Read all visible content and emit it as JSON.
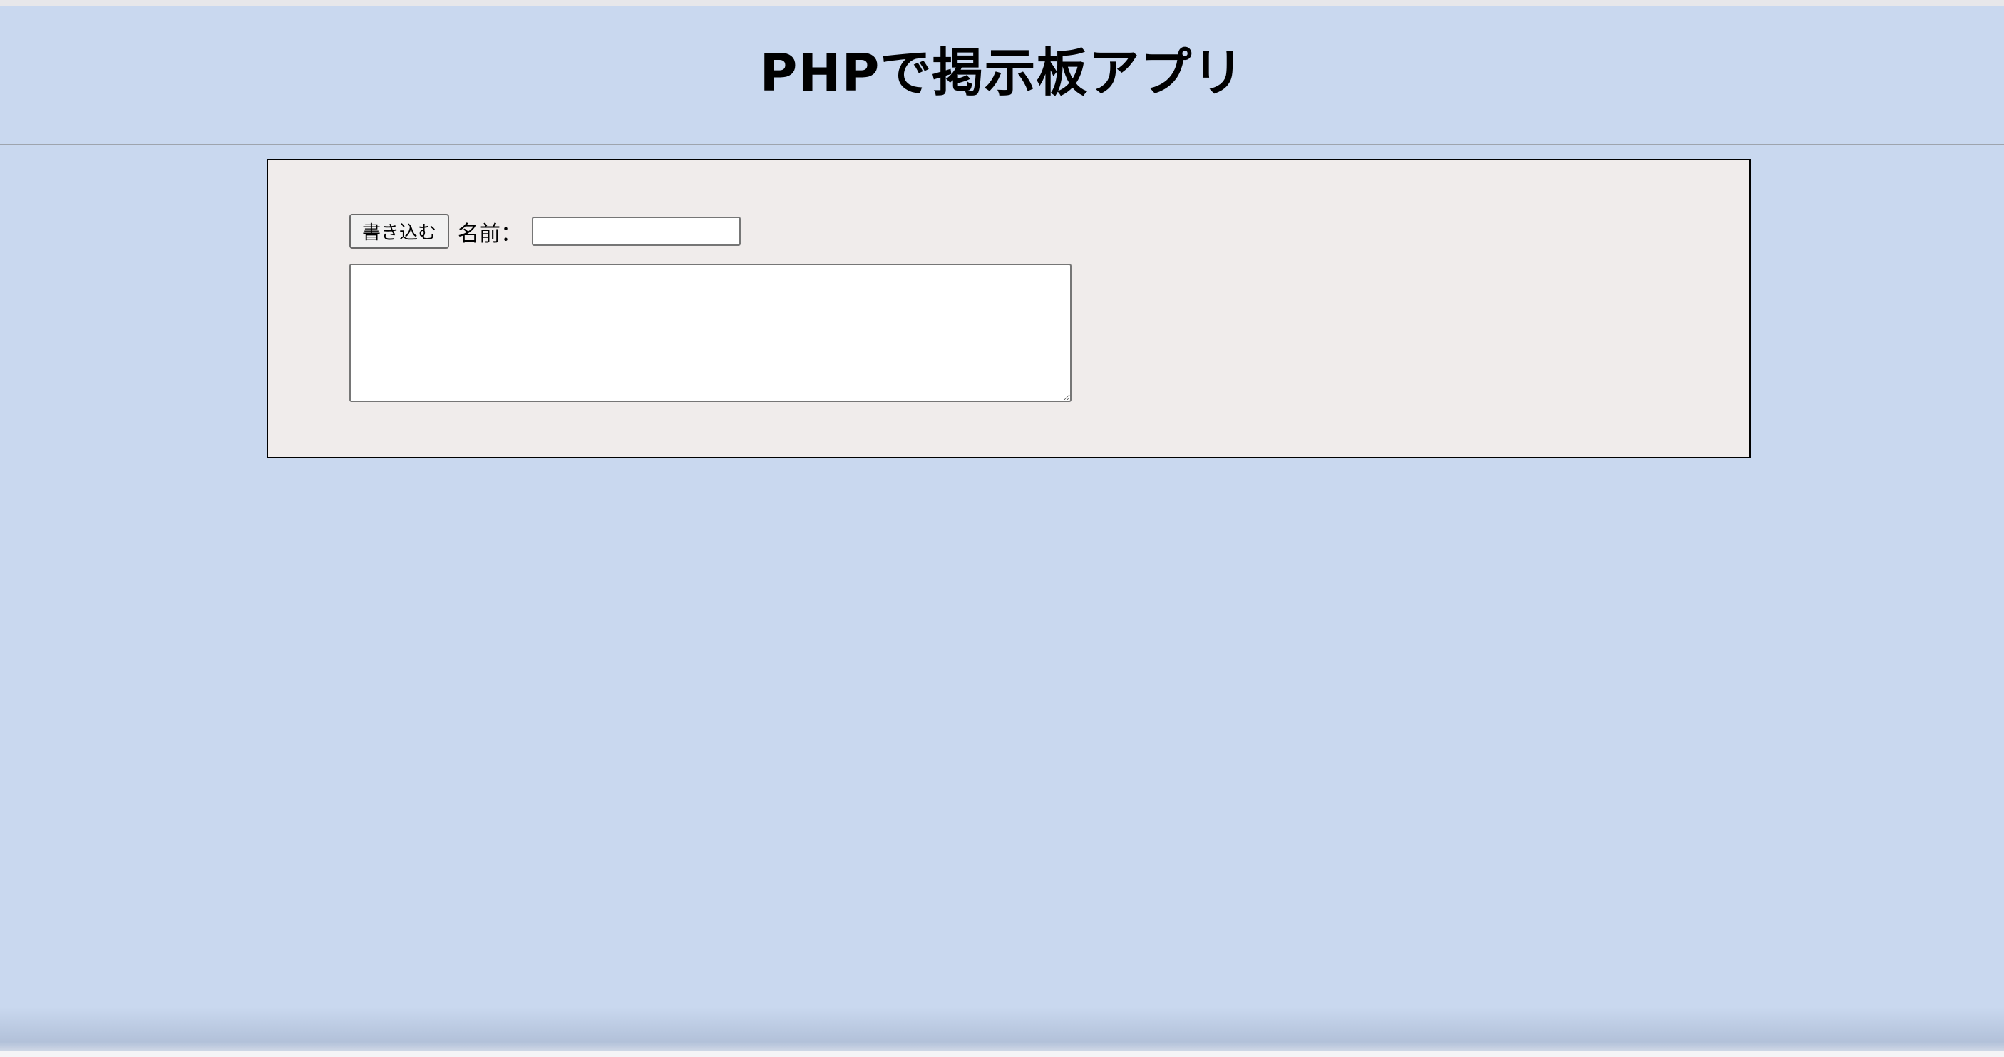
{
  "header": {
    "title": "PHPで掲示板アプリ"
  },
  "form": {
    "submit_label": "書き込む",
    "name_label": "名前：",
    "name_value": "",
    "message_value": ""
  },
  "colors": {
    "page_background": "#c9d8ef",
    "panel_background": "#f0eceb",
    "panel_border": "#000000"
  }
}
